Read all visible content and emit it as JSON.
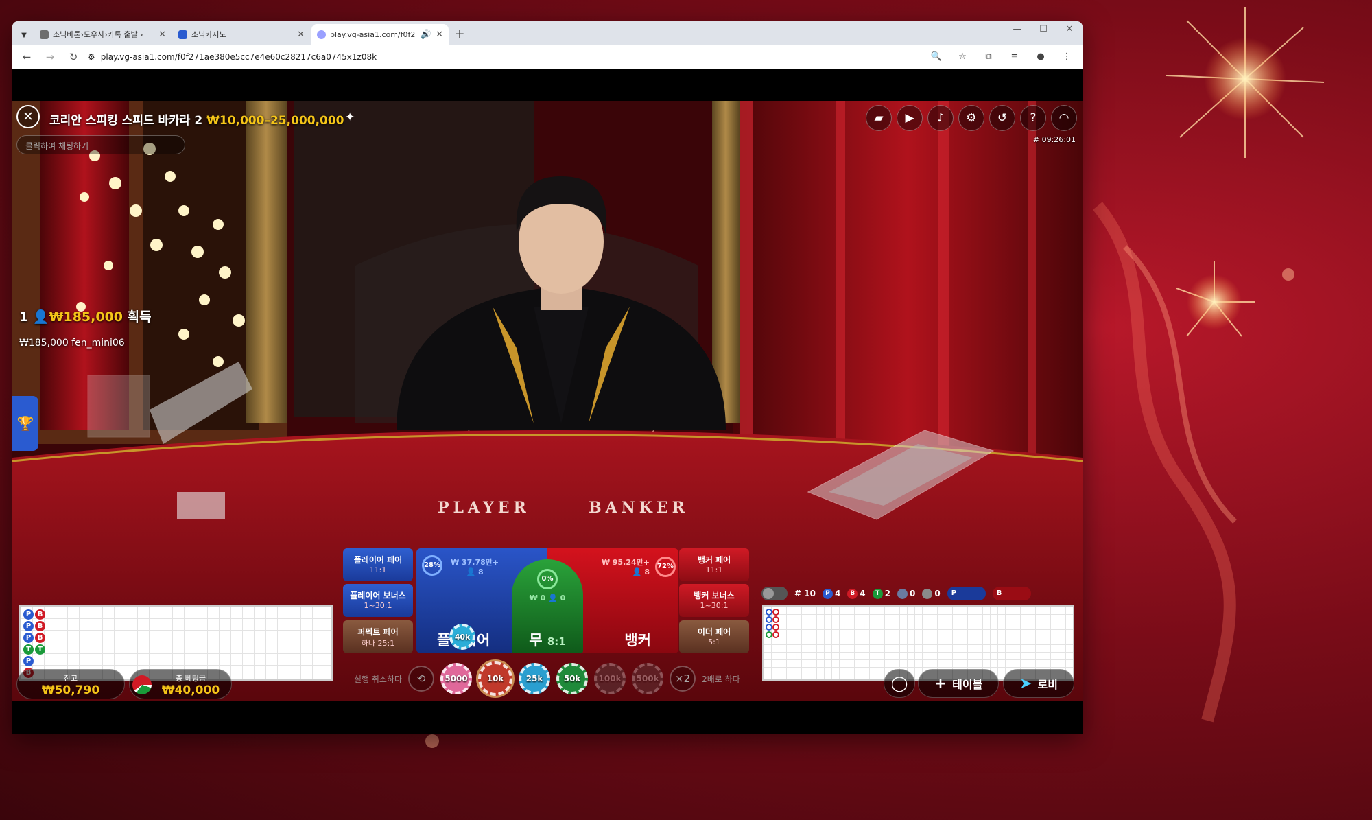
{
  "browser": {
    "tabs": [
      {
        "title": "소닉바톤›도우사›카톡 출발 ›",
        "favicon_color": "#6d6d6d",
        "active": false
      },
      {
        "title": "소닉카지노",
        "favicon_color": "#2a5bd0",
        "active": false
      },
      {
        "title": "play.vg-asia1.com/f0f271a",
        "favicon_color": "#9aa0ff",
        "active": true
      }
    ],
    "url": "play.vg-asia1.com/f0f271ae380e5cc7e4e60c28217c6a0745x1z08k",
    "icons": {
      "back": "back-arrow-icon",
      "forward": "forward-arrow-icon",
      "reload": "reload-icon",
      "zoom": "zoom-icon",
      "bookmark": "star-icon",
      "extensions": "puzzle-icon",
      "profile": "avatar-icon",
      "menu": "kebab-menu-icon"
    }
  },
  "game": {
    "title": "코리안 스피킹 스피드 바카라 2",
    "limits": "₩10,000–25,000,000",
    "chat_placeholder": "클릭하여 채팅하기",
    "game_id": "# 09:26:01",
    "top_icons": [
      "chat-icon",
      "video-icon",
      "volume-icon",
      "settings-icon",
      "history-icon",
      "help-icon",
      "headset-icon"
    ],
    "winner_banner": {
      "rank": "1",
      "amount": "₩185,000",
      "suffix": "획득"
    },
    "winner_detail": "₩185,000  fen_mini06",
    "table_felt": {
      "player": "PLAYER",
      "banker": "BANKER"
    }
  },
  "bets": {
    "player_pair": {
      "label": "플레이어 페어",
      "odds": "11:1"
    },
    "player_bonus": {
      "label": "플레이어 보너스",
      "odds": "1~30:1"
    },
    "perfect_pair": {
      "label": "퍼펙트 페어",
      "odds": "하나 25:1"
    },
    "player": {
      "label": "플레이어",
      "pool": "₩ 37.78만+",
      "players": "8",
      "pct": "28%",
      "chip": "40k"
    },
    "tie": {
      "label": "무",
      "odds": "8:1",
      "pool": "₩ 0",
      "players": "0",
      "pct": "0%"
    },
    "banker": {
      "label": "뱅커",
      "pool": "₩ 95.24만+",
      "players": "8",
      "pct": "72%"
    },
    "banker_pair": {
      "label": "뱅커 페어",
      "odds": "11:1"
    },
    "banker_bonus": {
      "label": "뱅커 보너스",
      "odds": "1~30:1"
    },
    "either_pair": {
      "label": "이더 페어",
      "odds": "5:1"
    }
  },
  "bead_road": [
    "P",
    "B",
    "P",
    "B",
    "P",
    "B",
    "T",
    "T",
    "P",
    "B"
  ],
  "stats": {
    "round": "# 10",
    "player": "4",
    "banker": "4",
    "tie": "2",
    "player_pair": "0",
    "banker_pair": "0",
    "p_label": "P",
    "b_label": "B",
    "t_label": "T"
  },
  "colors": {
    "player": "#2a5bd0",
    "banker": "#d01a25",
    "tie": "#1a9a3a",
    "gold": "#f5c518"
  },
  "chips": {
    "undo_label": "실행 취소하다",
    "double_label": "2배로 하다",
    "double_symbol": "×2",
    "items": [
      {
        "label": "5000",
        "color": "#e0689a",
        "active": true
      },
      {
        "label": "10k",
        "color": "#c0392b",
        "active": true
      },
      {
        "label": "25k",
        "color": "#2a9fd0",
        "active": true
      },
      {
        "label": "50k",
        "color": "#1f8a3a",
        "active": true
      },
      {
        "label": "100k",
        "color": "#555555",
        "active": false
      },
      {
        "label": "500k",
        "color": "#5a4a4a",
        "active": false
      }
    ]
  },
  "balance": {
    "label": "잔고",
    "value": "₩50,790"
  },
  "total_bet": {
    "label": "총 베팅금",
    "value": "₩40,000"
  },
  "buttons": {
    "table": "테이블",
    "lobby": "로비"
  }
}
